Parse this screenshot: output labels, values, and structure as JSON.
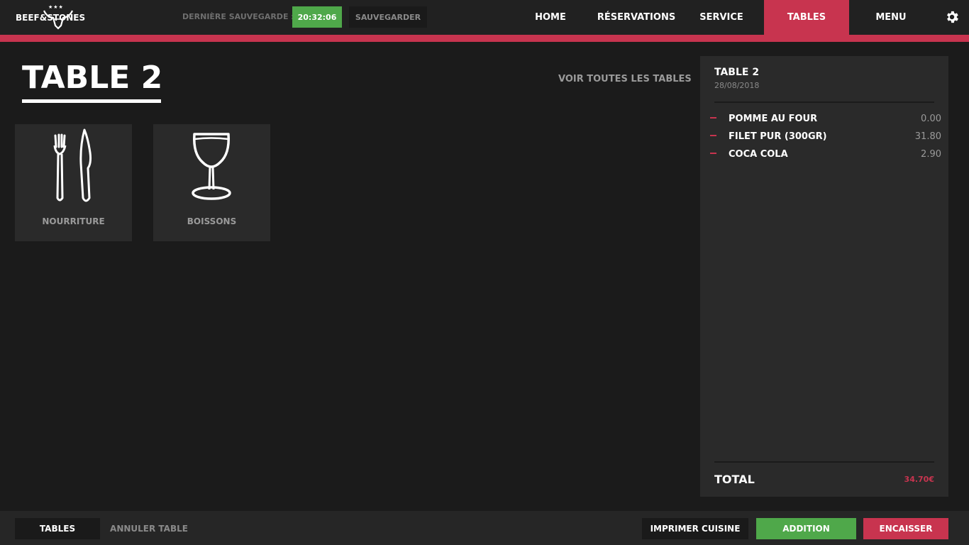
{
  "header": {
    "logo_text": "BEEF&STONES",
    "save_label": "DERNIÈRE SAUVEGARDE :",
    "save_time": "20:32:06",
    "save_button": "SAUVEGARDER",
    "nav": [
      {
        "label": "HOME",
        "active": false
      },
      {
        "label": "RÉSERVATIONS",
        "active": false
      },
      {
        "label": "SERVICE",
        "active": false
      },
      {
        "label": "TABLES",
        "active": true
      },
      {
        "label": "MENU",
        "active": false
      }
    ],
    "settings_icon": "gear-icon"
  },
  "main": {
    "title": "TABLE 2",
    "see_all_link": "VOIR TOUTES LES TABLES",
    "categories": [
      {
        "label": "NOURRITURE",
        "icon": "fork-knife-icon"
      },
      {
        "label": "BOISSONS",
        "icon": "wine-glass-icon"
      }
    ]
  },
  "order": {
    "table": "TABLE 2",
    "date": "28/08/2018",
    "items": [
      {
        "name": "POMME AU FOUR",
        "price": "0.00"
      },
      {
        "name": "FILET PUR (300GR)",
        "price": "31.80"
      },
      {
        "name": "COCA COLA",
        "price": "2.90"
      }
    ],
    "total_label": "TOTAL",
    "total_value": "34.70€"
  },
  "footer": {
    "tables_button": "TABLES",
    "cancel_table": "ANNULER TABLE",
    "print_kitchen": "IMPRIMER CUISINE",
    "bill": "ADDITION",
    "cash_in": "ENCAISSER"
  },
  "colors": {
    "accent": "#c8344f",
    "success": "#4fa84a",
    "background": "#1b1b1b",
    "panel": "#2a2a2a"
  }
}
